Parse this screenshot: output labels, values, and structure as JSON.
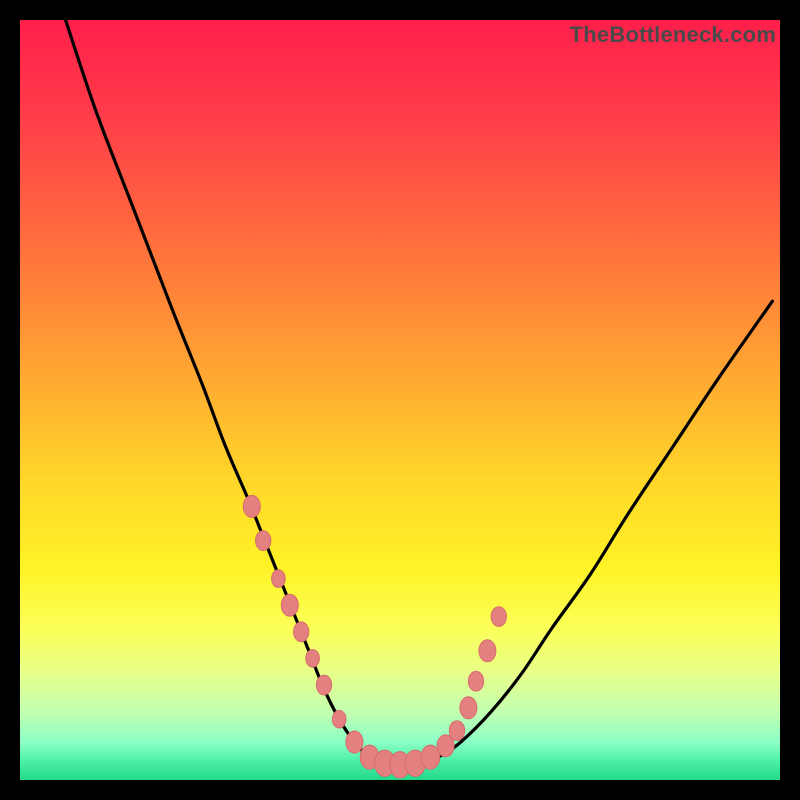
{
  "watermark": "TheBottleneck.com",
  "colors": {
    "frame": "#000000",
    "curve": "#000000",
    "marker_fill": "#e58080",
    "marker_stroke": "#d66b6b",
    "gradient_stops": [
      {
        "offset": 0.0,
        "color": "#ff1f4b"
      },
      {
        "offset": 0.12,
        "color": "#ff3b4a"
      },
      {
        "offset": 0.28,
        "color": "#ff6a3e"
      },
      {
        "offset": 0.45,
        "color": "#ffa233"
      },
      {
        "offset": 0.6,
        "color": "#ffd52a"
      },
      {
        "offset": 0.72,
        "color": "#fff326"
      },
      {
        "offset": 0.8,
        "color": "#fbff57"
      },
      {
        "offset": 0.86,
        "color": "#e7ff8a"
      },
      {
        "offset": 0.91,
        "color": "#c3ffb0"
      },
      {
        "offset": 0.95,
        "color": "#8cffc6"
      },
      {
        "offset": 0.975,
        "color": "#4cf0a8"
      },
      {
        "offset": 1.0,
        "color": "#22d98a"
      }
    ]
  },
  "chart_data": {
    "type": "line",
    "title": "",
    "xlabel": "",
    "ylabel": "",
    "xlim": [
      0,
      100
    ],
    "ylim": [
      0,
      100
    ],
    "grid": false,
    "series": [
      {
        "name": "bottleneck-curve",
        "x": [
          6,
          10,
          15,
          20,
          24,
          27,
          30,
          32,
          34,
          36,
          38,
          40,
          42,
          44,
          46,
          48,
          50,
          52,
          55,
          58,
          62,
          66,
          70,
          75,
          80,
          86,
          92,
          99
        ],
        "values": [
          100,
          88,
          75,
          62,
          52,
          44,
          37,
          32,
          27,
          22,
          17,
          12,
          8,
          5,
          3,
          2,
          2,
          2,
          3,
          5,
          9,
          14,
          20,
          27,
          35,
          44,
          53,
          63
        ]
      }
    ],
    "markers": {
      "name": "highlighted-points",
      "x": [
        30.5,
        32.0,
        34.0,
        35.5,
        37.0,
        38.5,
        40.0,
        42.0,
        44.0,
        46.0,
        48.0,
        50.0,
        52.0,
        54.0,
        56.0,
        57.5,
        59.0,
        60.0,
        61.5,
        63.0
      ],
      "values": [
        36.0,
        31.5,
        26.5,
        23.0,
        19.5,
        16.0,
        12.5,
        8.0,
        5.0,
        3.0,
        2.2,
        2.0,
        2.2,
        3.0,
        4.5,
        6.5,
        9.5,
        13.0,
        17.0,
        21.5
      ],
      "radius": [
        10,
        9,
        8,
        10,
        9,
        8,
        9,
        8,
        10,
        11,
        12,
        12,
        12,
        11,
        10,
        9,
        10,
        9,
        10,
        9
      ]
    }
  }
}
